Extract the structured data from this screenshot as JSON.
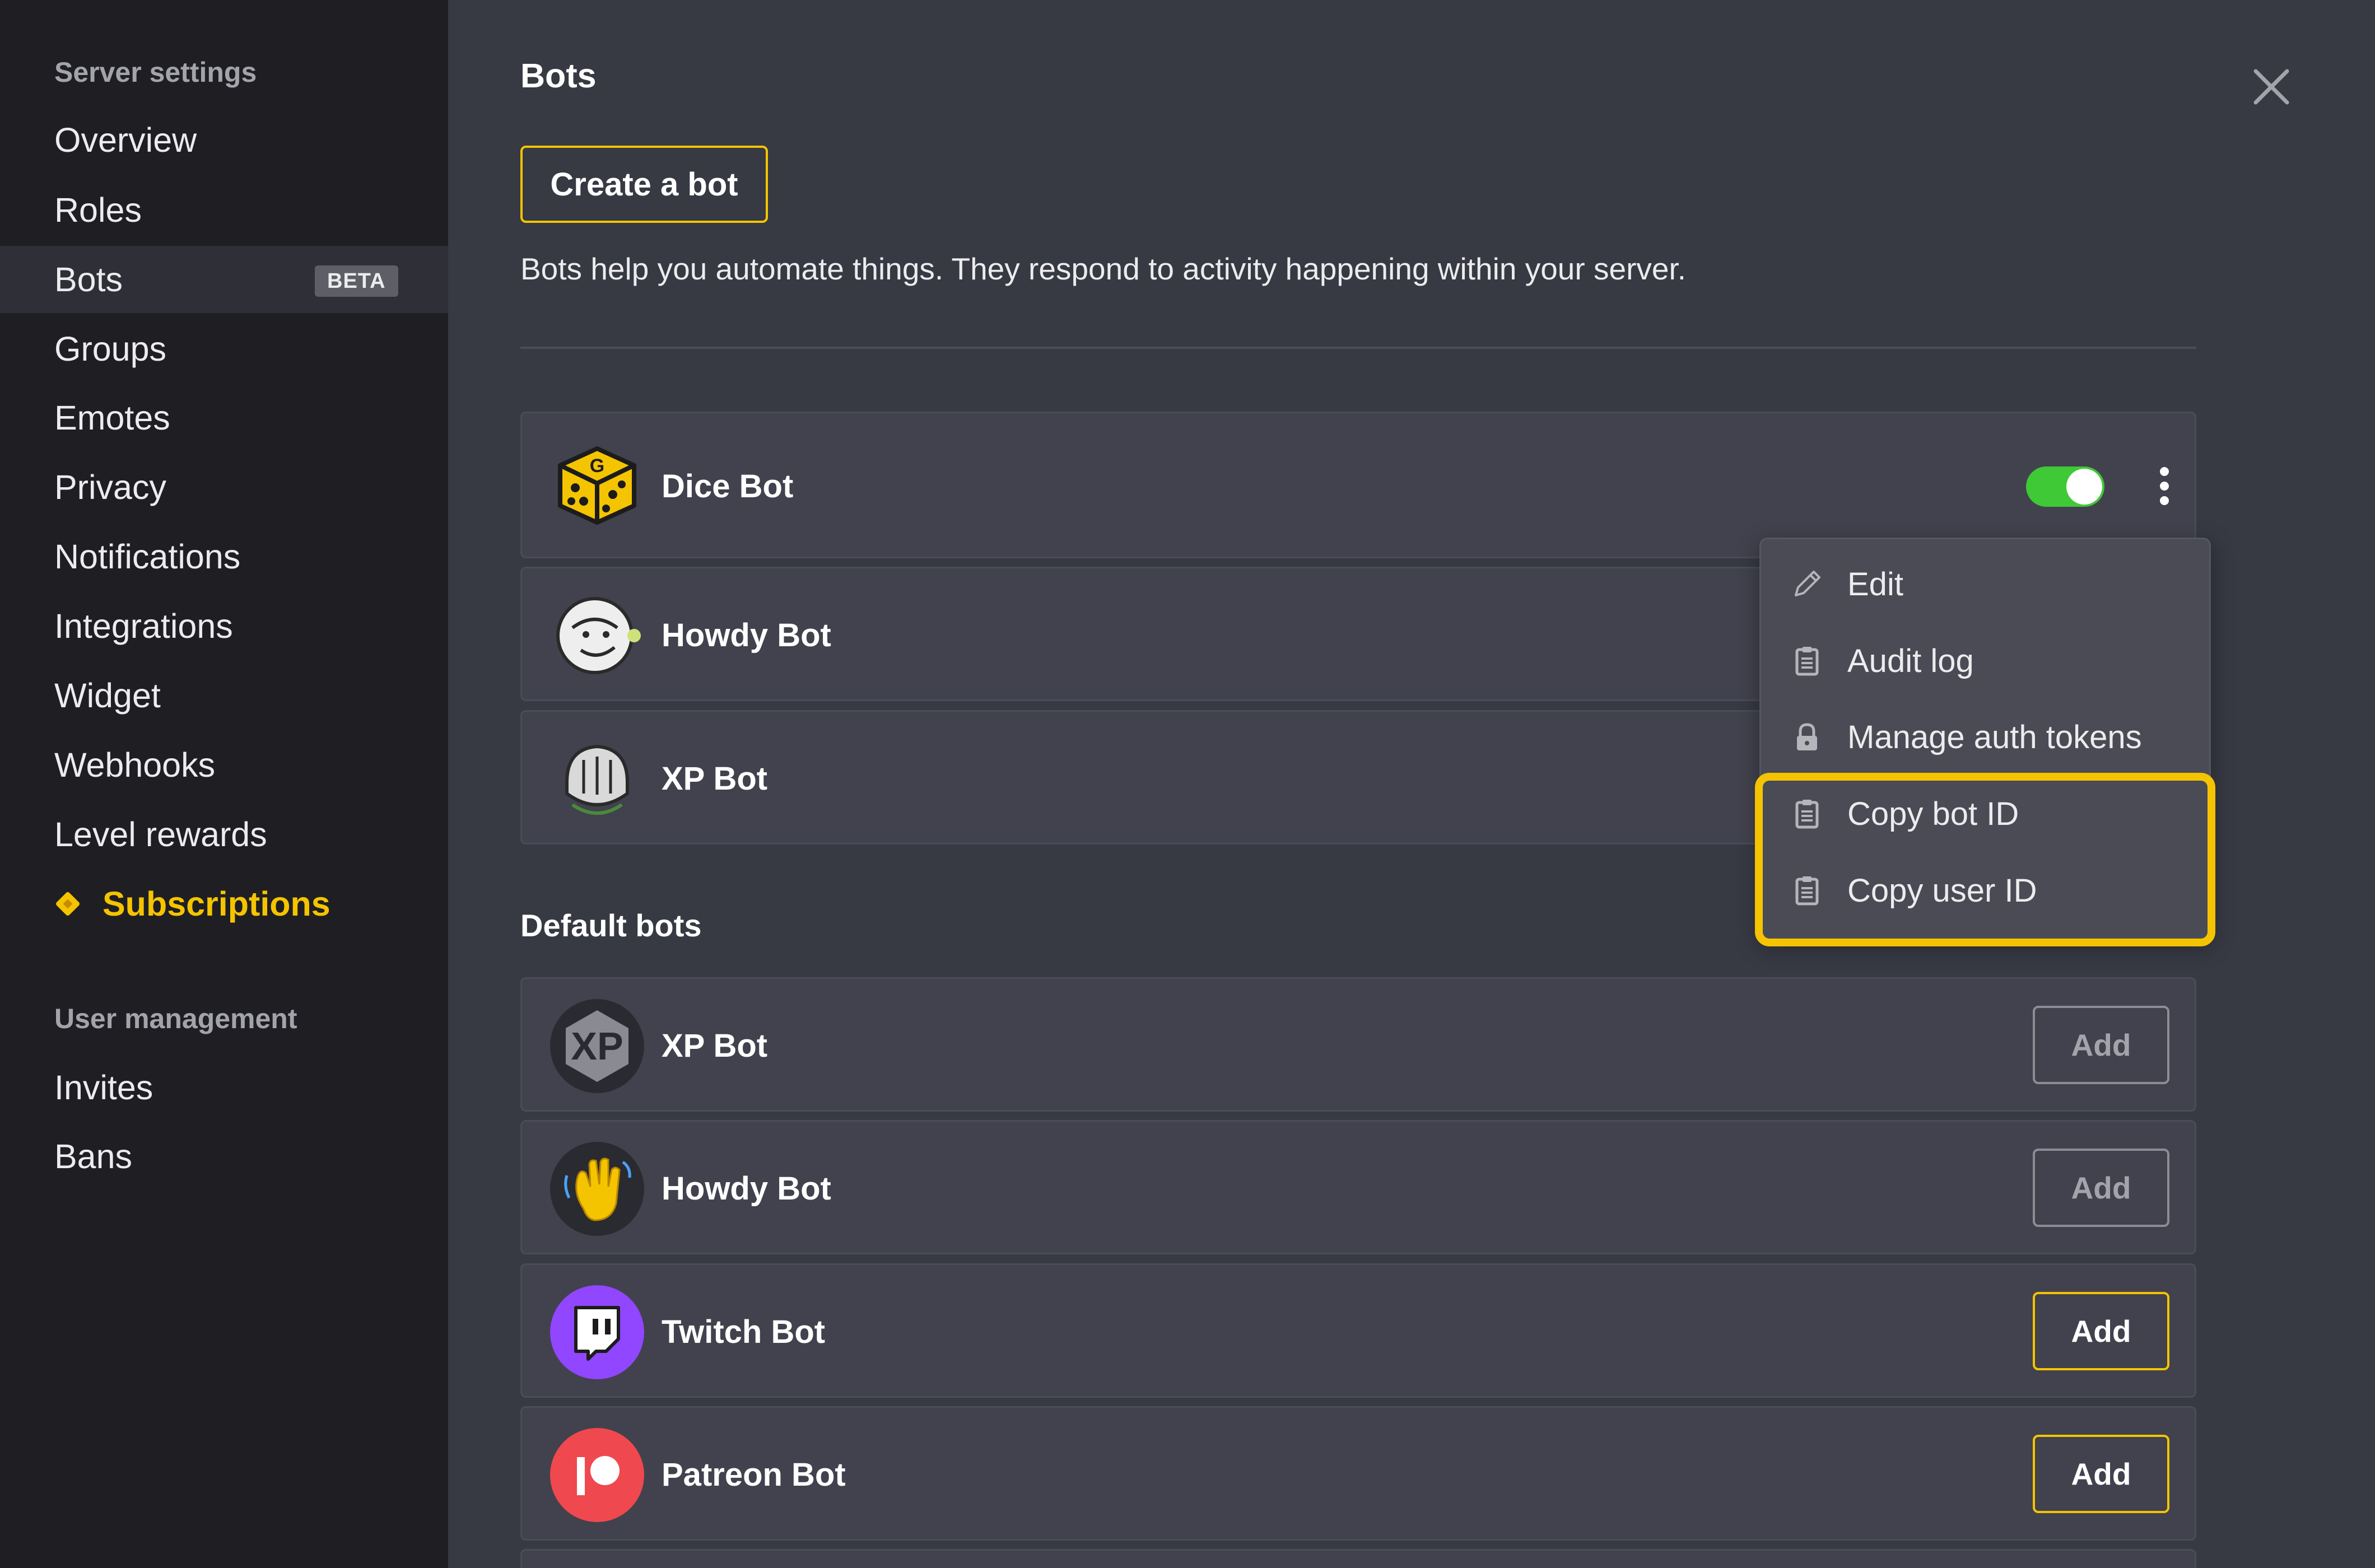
{
  "sidebar": {
    "server_heading": "Server settings",
    "items": [
      {
        "label": "Overview"
      },
      {
        "label": "Roles"
      },
      {
        "label": "Bots",
        "badge": "BETA",
        "active": true
      },
      {
        "label": "Groups"
      },
      {
        "label": "Emotes"
      },
      {
        "label": "Privacy"
      },
      {
        "label": "Notifications"
      },
      {
        "label": "Integrations"
      },
      {
        "label": "Widget"
      },
      {
        "label": "Webhooks"
      },
      {
        "label": "Level rewards"
      },
      {
        "label": "Subscriptions",
        "icon": "diamond-icon",
        "highlighted": true
      }
    ],
    "user_heading": "User management",
    "user_items": [
      {
        "label": "Invites"
      },
      {
        "label": "Bans"
      }
    ]
  },
  "main": {
    "title": "Bots",
    "create_button": "Create a bot",
    "description": "Bots help you automate things. They respond to activity happening within your server.",
    "bots": [
      {
        "name": "Dice Bot",
        "icon": "dice-icon",
        "enabled": true
      },
      {
        "name": "Howdy Bot",
        "icon": "howdy-avatar"
      },
      {
        "name": "XP Bot",
        "icon": "knight-avatar"
      }
    ],
    "default_heading": "Default bots",
    "default_bots": [
      {
        "name": "XP Bot",
        "icon": "xp-icon",
        "button": "Add",
        "enabled": false
      },
      {
        "name": "Howdy Bot",
        "icon": "wave-icon",
        "button": "Add",
        "enabled": false
      },
      {
        "name": "Twitch Bot",
        "icon": "twitch-icon",
        "button": "Add",
        "enabled": true
      },
      {
        "name": "Patreon Bot",
        "icon": "patreon-icon",
        "button": "Add",
        "enabled": true
      }
    ]
  },
  "context_menu": {
    "items": [
      {
        "label": "Edit",
        "icon": "pencil-icon"
      },
      {
        "label": "Audit log",
        "icon": "clipboard-icon"
      },
      {
        "label": "Manage auth tokens",
        "icon": "lock-icon"
      },
      {
        "label": "Copy bot ID",
        "icon": "clipboard-icon"
      },
      {
        "label": "Copy user ID",
        "icon": "clipboard-icon"
      }
    ]
  },
  "colors": {
    "accent": "#f5c400",
    "sidebar_bg": "#1f1f23",
    "main_bg": "#373943",
    "card_bg": "#41424d",
    "toggle_on": "#3fc936",
    "twitch": "#9146ff",
    "patreon": "#f0484f"
  }
}
